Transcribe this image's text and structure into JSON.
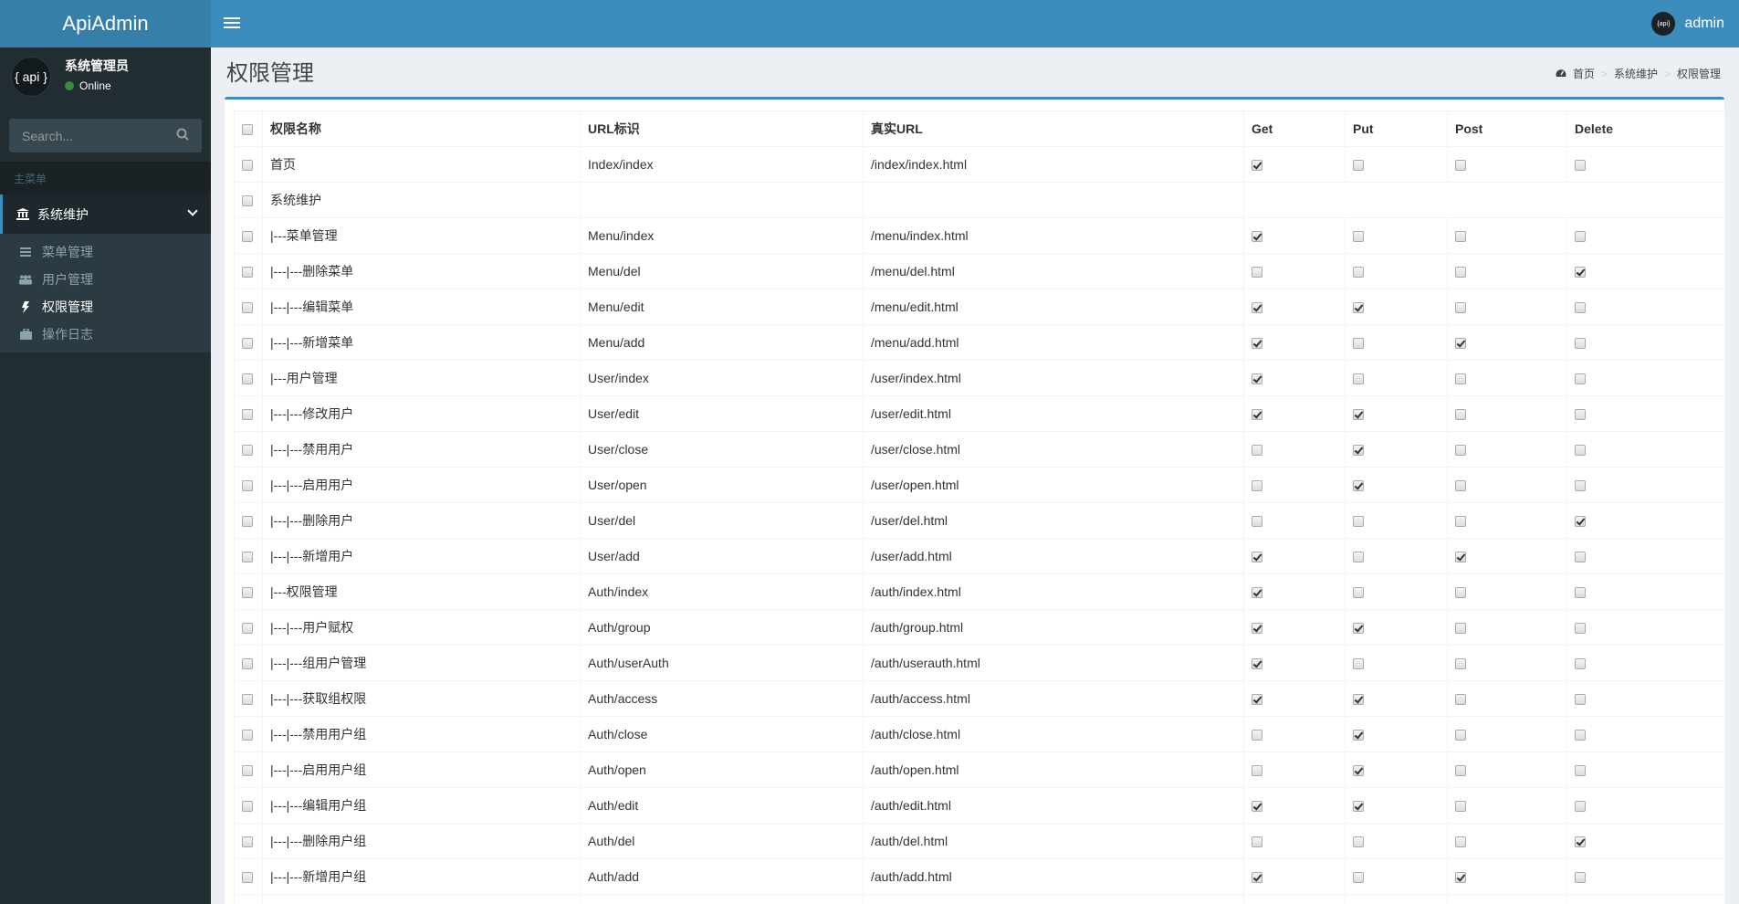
{
  "app": {
    "logo": "ApiAdmin",
    "user": "admin",
    "avatar_text": "{ api }",
    "mini_avatar_text": "{api}"
  },
  "sidebar": {
    "user_name": "系统管理员",
    "status": "Online",
    "status_color": "#3c8b3c",
    "search_placeholder": "Search...",
    "header": "主菜单",
    "group": {
      "label": "系统维护",
      "icon": "bank-icon"
    },
    "items": [
      {
        "label": "菜单管理",
        "icon": "bars-icon",
        "active": false
      },
      {
        "label": "用户管理",
        "icon": "users-icon",
        "active": false
      },
      {
        "label": "权限管理",
        "icon": "bolt-icon",
        "active": true
      },
      {
        "label": "操作日志",
        "icon": "briefcase-icon",
        "active": false
      }
    ]
  },
  "page": {
    "title": "权限管理",
    "breadcrumb": [
      "首页",
      "系统维护",
      "权限管理"
    ]
  },
  "table": {
    "headers": [
      "权限名称",
      "URL标识",
      "真实URL",
      "Get",
      "Put",
      "Post",
      "Delete"
    ],
    "rows": [
      {
        "name": "首页",
        "url": "Index/index",
        "real": "/index/index.html",
        "perms": [
          1,
          0,
          0,
          0
        ]
      },
      {
        "name": "系统维护",
        "url": "",
        "real": "",
        "perms": null
      },
      {
        "name": "|---菜单管理",
        "url": "Menu/index",
        "real": "/menu/index.html",
        "perms": [
          1,
          0,
          0,
          0
        ]
      },
      {
        "name": "|---|---删除菜单",
        "url": "Menu/del",
        "real": "/menu/del.html",
        "perms": [
          0,
          0,
          0,
          1
        ]
      },
      {
        "name": "|---|---编辑菜单",
        "url": "Menu/edit",
        "real": "/menu/edit.html",
        "perms": [
          1,
          1,
          0,
          0
        ]
      },
      {
        "name": "|---|---新增菜单",
        "url": "Menu/add",
        "real": "/menu/add.html",
        "perms": [
          1,
          0,
          1,
          0
        ]
      },
      {
        "name": "|---用户管理",
        "url": "User/index",
        "real": "/user/index.html",
        "perms": [
          1,
          0,
          0,
          0
        ]
      },
      {
        "name": "|---|---修改用户",
        "url": "User/edit",
        "real": "/user/edit.html",
        "perms": [
          1,
          1,
          0,
          0
        ]
      },
      {
        "name": "|---|---禁用用户",
        "url": "User/close",
        "real": "/user/close.html",
        "perms": [
          0,
          1,
          0,
          0
        ]
      },
      {
        "name": "|---|---启用用户",
        "url": "User/open",
        "real": "/user/open.html",
        "perms": [
          0,
          1,
          0,
          0
        ]
      },
      {
        "name": "|---|---删除用户",
        "url": "User/del",
        "real": "/user/del.html",
        "perms": [
          0,
          0,
          0,
          1
        ]
      },
      {
        "name": "|---|---新增用户",
        "url": "User/add",
        "real": "/user/add.html",
        "perms": [
          1,
          0,
          1,
          0
        ]
      },
      {
        "name": "|---权限管理",
        "url": "Auth/index",
        "real": "/auth/index.html",
        "perms": [
          1,
          0,
          0,
          0
        ]
      },
      {
        "name": "|---|---用户赋权",
        "url": "Auth/group",
        "real": "/auth/group.html",
        "perms": [
          1,
          1,
          0,
          0
        ]
      },
      {
        "name": "|---|---组用户管理",
        "url": "Auth/userAuth",
        "real": "/auth/userauth.html",
        "perms": [
          1,
          0,
          0,
          0
        ]
      },
      {
        "name": "|---|---获取组权限",
        "url": "Auth/access",
        "real": "/auth/access.html",
        "perms": [
          1,
          1,
          0,
          0
        ]
      },
      {
        "name": "|---|---禁用用户组",
        "url": "Auth/close",
        "real": "/auth/close.html",
        "perms": [
          0,
          1,
          0,
          0
        ]
      },
      {
        "name": "|---|---启用用户组",
        "url": "Auth/open",
        "real": "/auth/open.html",
        "perms": [
          0,
          1,
          0,
          0
        ]
      },
      {
        "name": "|---|---编辑用户组",
        "url": "Auth/edit",
        "real": "/auth/edit.html",
        "perms": [
          1,
          1,
          0,
          0
        ]
      },
      {
        "name": "|---|---删除用户组",
        "url": "Auth/del",
        "real": "/auth/del.html",
        "perms": [
          0,
          0,
          0,
          1
        ]
      },
      {
        "name": "|---|---新增用户组",
        "url": "Auth/add",
        "real": "/auth/add.html",
        "perms": [
          1,
          0,
          1,
          0
        ]
      },
      {
        "name": "|",
        "url": "",
        "real": "",
        "perms": [
          0,
          0,
          0,
          0
        ]
      }
    ]
  },
  "colors": {
    "brand": "#3c8dbc",
    "brand_dark": "#367fa9",
    "sidebar": "#222d32"
  }
}
